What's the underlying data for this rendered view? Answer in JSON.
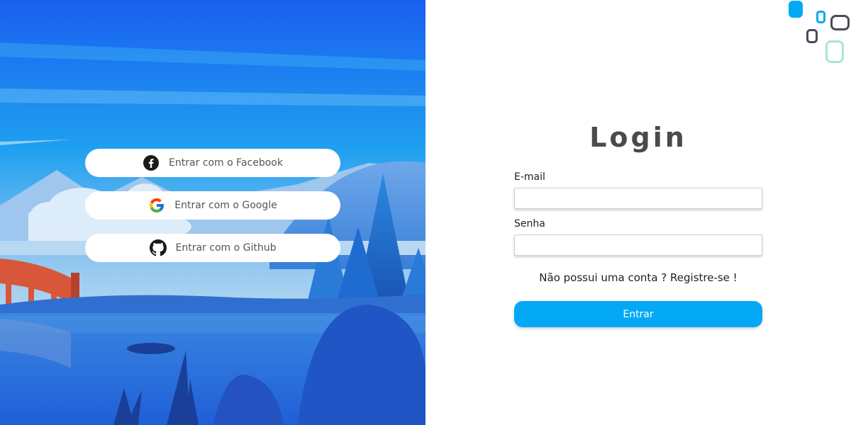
{
  "social": {
    "facebook_label": "Entrar com o Facebook",
    "google_label": "Entrar com o Google",
    "github_label": "Entrar com o Github"
  },
  "form": {
    "title": "Login",
    "email_label": "E-mail",
    "email_value": "",
    "password_label": "Senha",
    "password_value": "",
    "register_question": "Não possui uma conta ?",
    "register_link": "Registre-se !",
    "submit_label": "Entrar"
  },
  "icons": {
    "facebook": "facebook-icon",
    "google": "google-icon",
    "github": "github-icon"
  },
  "colors": {
    "accent": "#03a9f4",
    "title": "#4a4a4a",
    "sky_top": "#1a6ef0",
    "lake": "#2c6fd8"
  }
}
